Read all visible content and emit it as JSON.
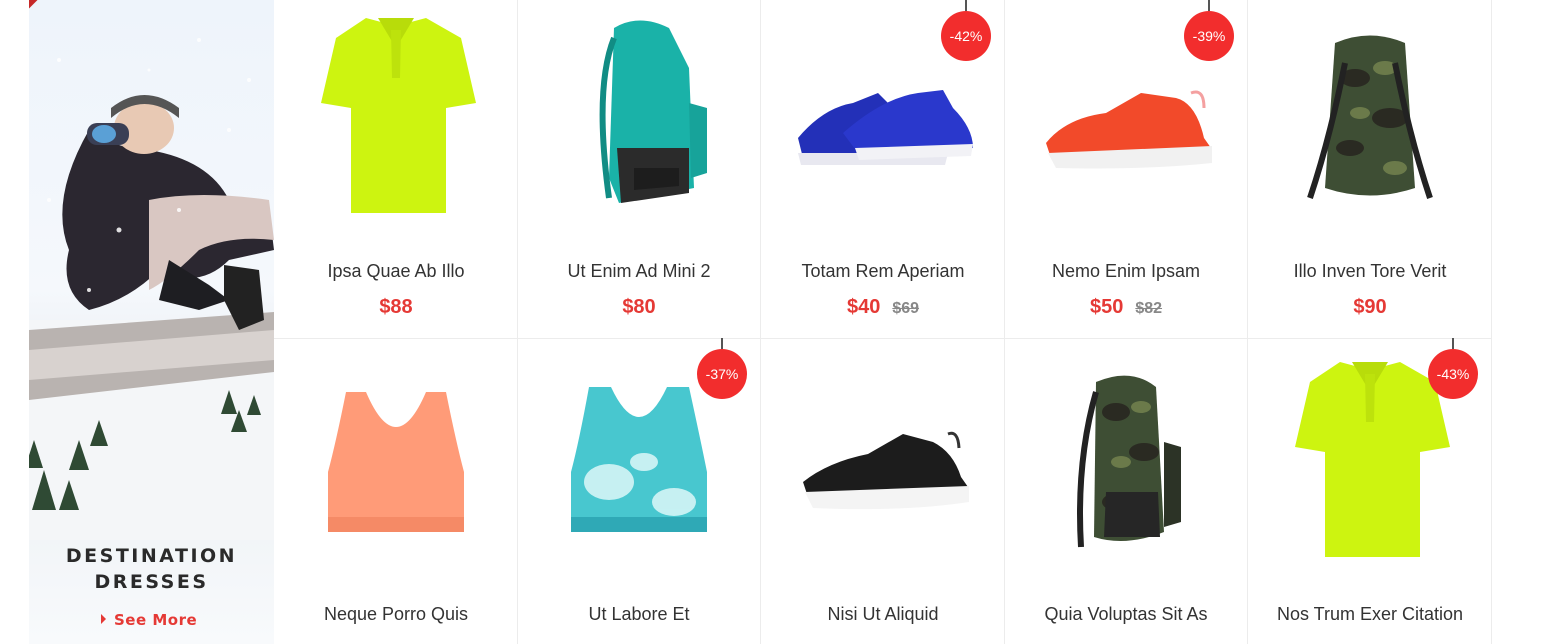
{
  "banner": {
    "title_line1": "DESTINATION",
    "title_line2": "DRESSES",
    "link": "See More"
  },
  "products": [
    {
      "name": "Ipsa Quae Ab Illo",
      "price": "$88",
      "old_price": "",
      "badge": "",
      "image": "lime-polo-shirt"
    },
    {
      "name": "Ut Enim Ad Mini 2",
      "price": "$80",
      "old_price": "",
      "badge": "",
      "image": "teal-backpack"
    },
    {
      "name": "Totam Rem Aperiam",
      "price": "$40",
      "old_price": "$69",
      "badge": "-42%",
      "image": "blue-sneakers"
    },
    {
      "name": "Nemo Enim Ipsam",
      "price": "$50",
      "old_price": "$82",
      "badge": "-39%",
      "image": "orange-sneaker"
    },
    {
      "name": "Illo Inven Tore Verit",
      "price": "$90",
      "old_price": "",
      "badge": "",
      "image": "camo-backpack-back"
    },
    {
      "name": "Neque Porro Quis",
      "price": "",
      "old_price": "",
      "badge": "",
      "image": "peach-sports-bra"
    },
    {
      "name": "Ut Labore Et",
      "price": "",
      "old_price": "",
      "badge": "-37%",
      "image": "tie-dye-sports-bra"
    },
    {
      "name": "Nisi Ut Aliquid",
      "price": "",
      "old_price": "",
      "badge": "",
      "image": "black-sneaker"
    },
    {
      "name": "Quia Voluptas Sit As",
      "price": "",
      "old_price": "",
      "badge": "",
      "image": "camo-backpack-side"
    },
    {
      "name": "Nos Trum Exer Citation",
      "price": "",
      "old_price": "",
      "badge": "-43%",
      "image": "lime-polo-shirt"
    }
  ],
  "colors": {
    "accent": "#e53935",
    "badge": "#f22d2d",
    "old_price": "#888888",
    "text": "#333333"
  }
}
